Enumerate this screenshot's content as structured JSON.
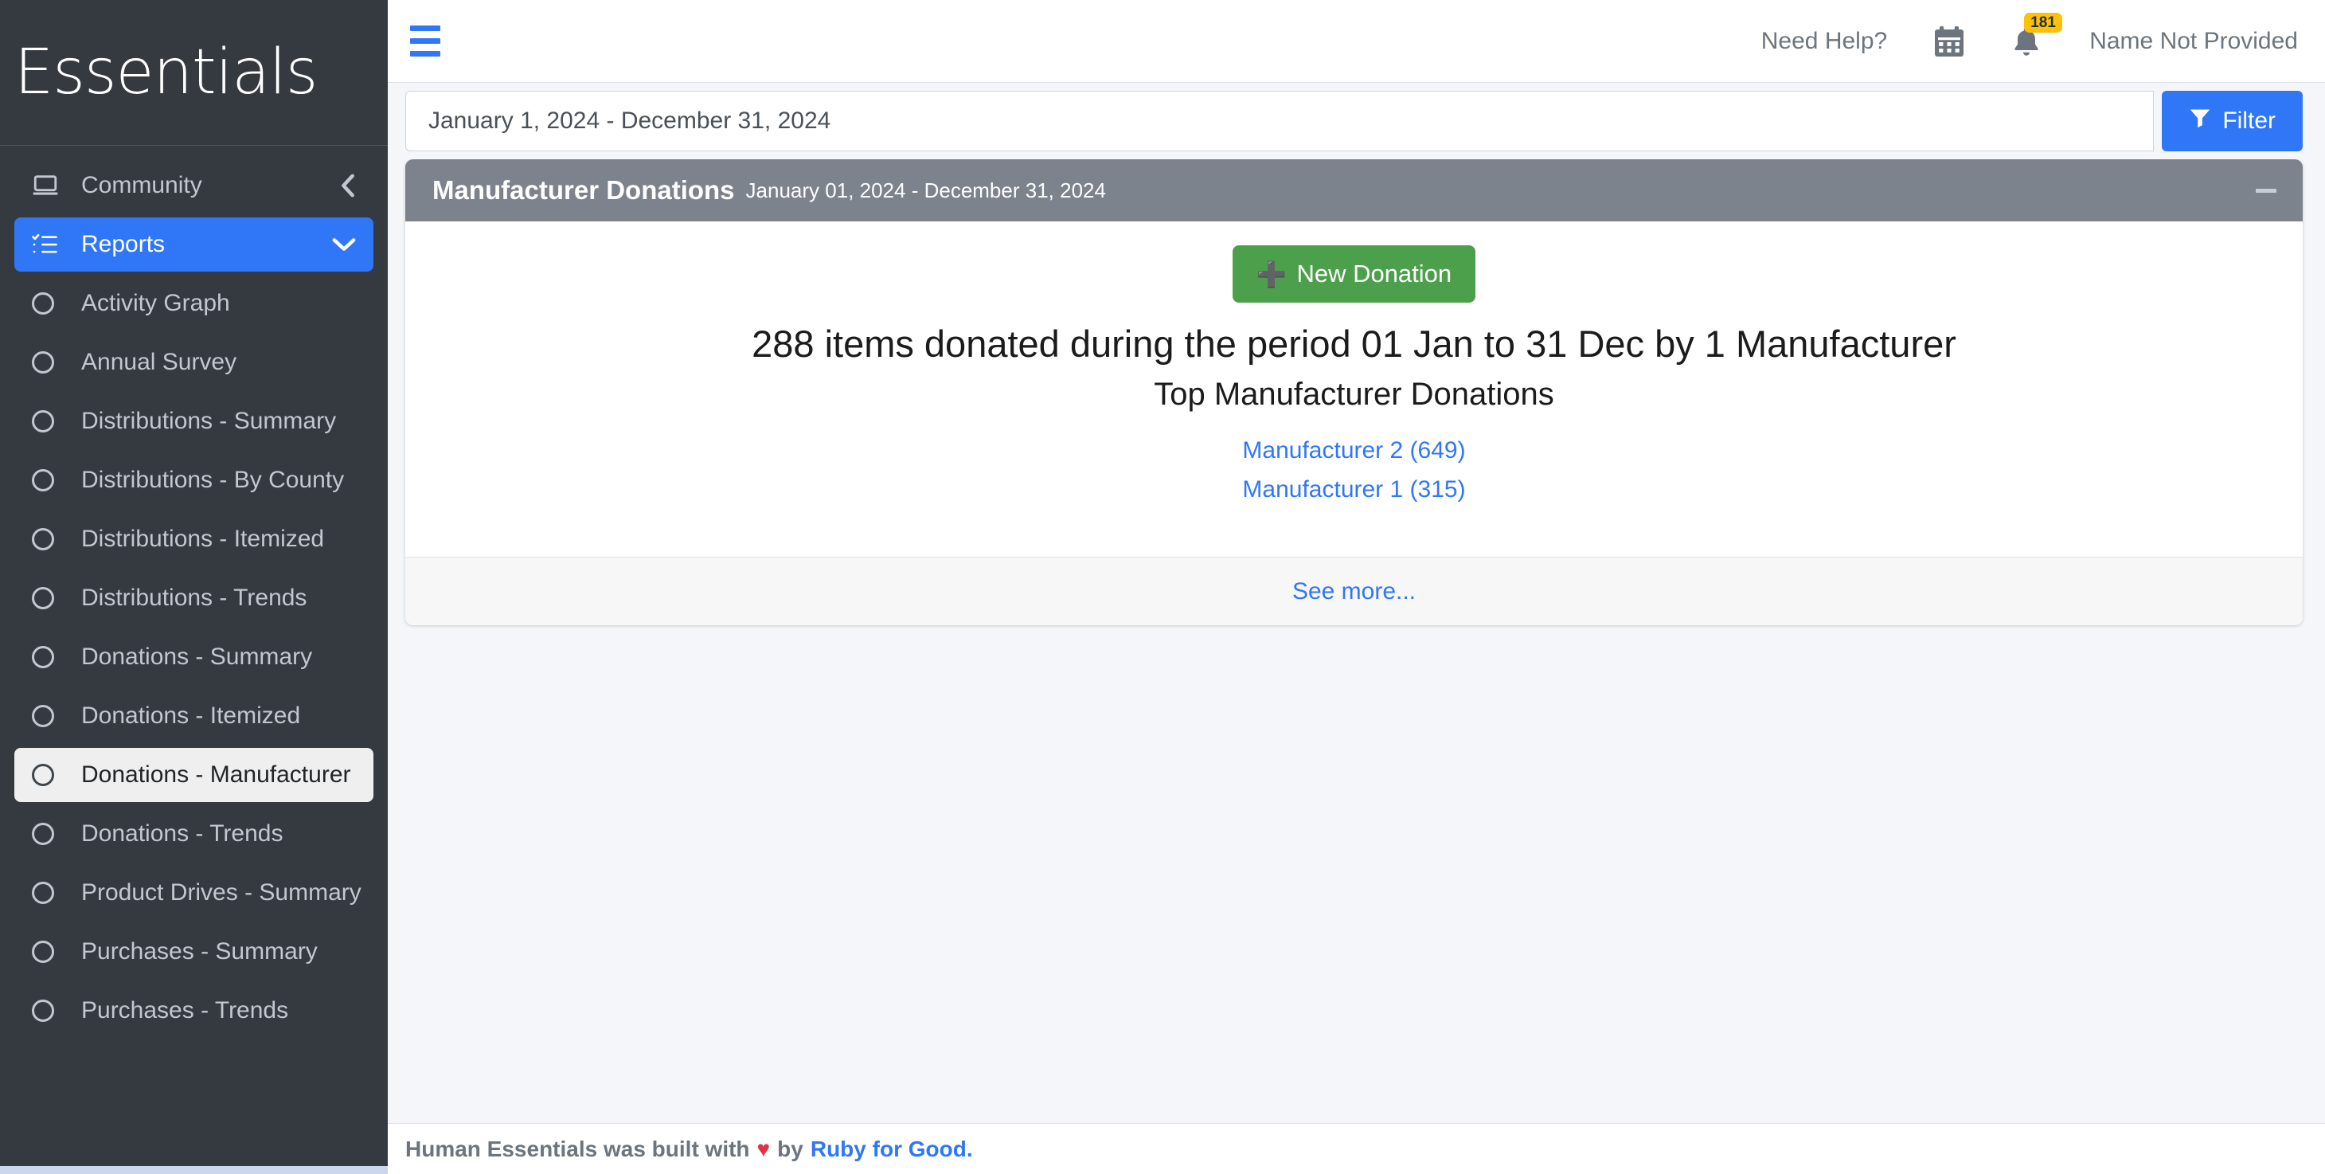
{
  "brand": {
    "name": "Essentials"
  },
  "sidebar": {
    "community": {
      "label": "Community",
      "icon": "laptop-icon",
      "caret": "chevron-left-icon"
    },
    "reports": {
      "label": "Reports",
      "icon": "list-check-icon",
      "caret": "chevron-down-icon"
    },
    "items": [
      {
        "label": "Activity Graph",
        "active": false
      },
      {
        "label": "Annual Survey",
        "active": false
      },
      {
        "label": "Distributions - Summary",
        "active": false
      },
      {
        "label": "Distributions - By County",
        "active": false
      },
      {
        "label": "Distributions - Itemized",
        "active": false
      },
      {
        "label": "Distributions - Trends",
        "active": false
      },
      {
        "label": "Donations - Summary",
        "active": false
      },
      {
        "label": "Donations - Itemized",
        "active": false
      },
      {
        "label": "Donations - Manufacturer",
        "active": true
      },
      {
        "label": "Donations - Trends",
        "active": false
      },
      {
        "label": "Product Drives - Summary",
        "active": false
      },
      {
        "label": "Purchases - Summary",
        "active": false
      },
      {
        "label": "Purchases - Trends",
        "active": false
      }
    ]
  },
  "topbar": {
    "menu_toggle": "hamburger-icon",
    "need_help": "Need Help?",
    "calendar_icon": "calendar-icon",
    "bell_icon": "bell-icon",
    "notification_count": "181",
    "user_name": "Name Not Provided"
  },
  "filter_bar": {
    "date_range_value": "January 1, 2024 - December 31, 2024",
    "date_range_placeholder": "January 1, 2024 - December 31, 2024",
    "filter_button": "Filter",
    "filter_icon": "funnel-icon"
  },
  "card": {
    "title": "Manufacturer Donations",
    "subtitle": "January 01, 2024 - December 31, 2024",
    "collapse_icon": "minus-icon",
    "new_donation_button": "New Donation",
    "new_donation_icon": "plus-icon",
    "headline": "288 items donated during the period 01 Jan to 31 Dec by 1 Manufacturer",
    "subhead": "Top Manufacturer Donations",
    "manufacturers": [
      {
        "label": "Manufacturer 2 (649)"
      },
      {
        "label": "Manufacturer 1 (315)"
      }
    ],
    "see_more": "See more..."
  },
  "footer": {
    "text_before": "Human Essentials was built with",
    "heart": "♥",
    "text_mid": "by",
    "link": "Ruby for Good.",
    "link_icon": "heart-icon"
  },
  "colors": {
    "accent_blue": "#3077f7",
    "sidebar_dark": "#343a40",
    "card_header_gray": "#7c838d",
    "green": "#4ca04c",
    "badge_yellow": "#ffc107",
    "heart_red": "#dc3545"
  }
}
